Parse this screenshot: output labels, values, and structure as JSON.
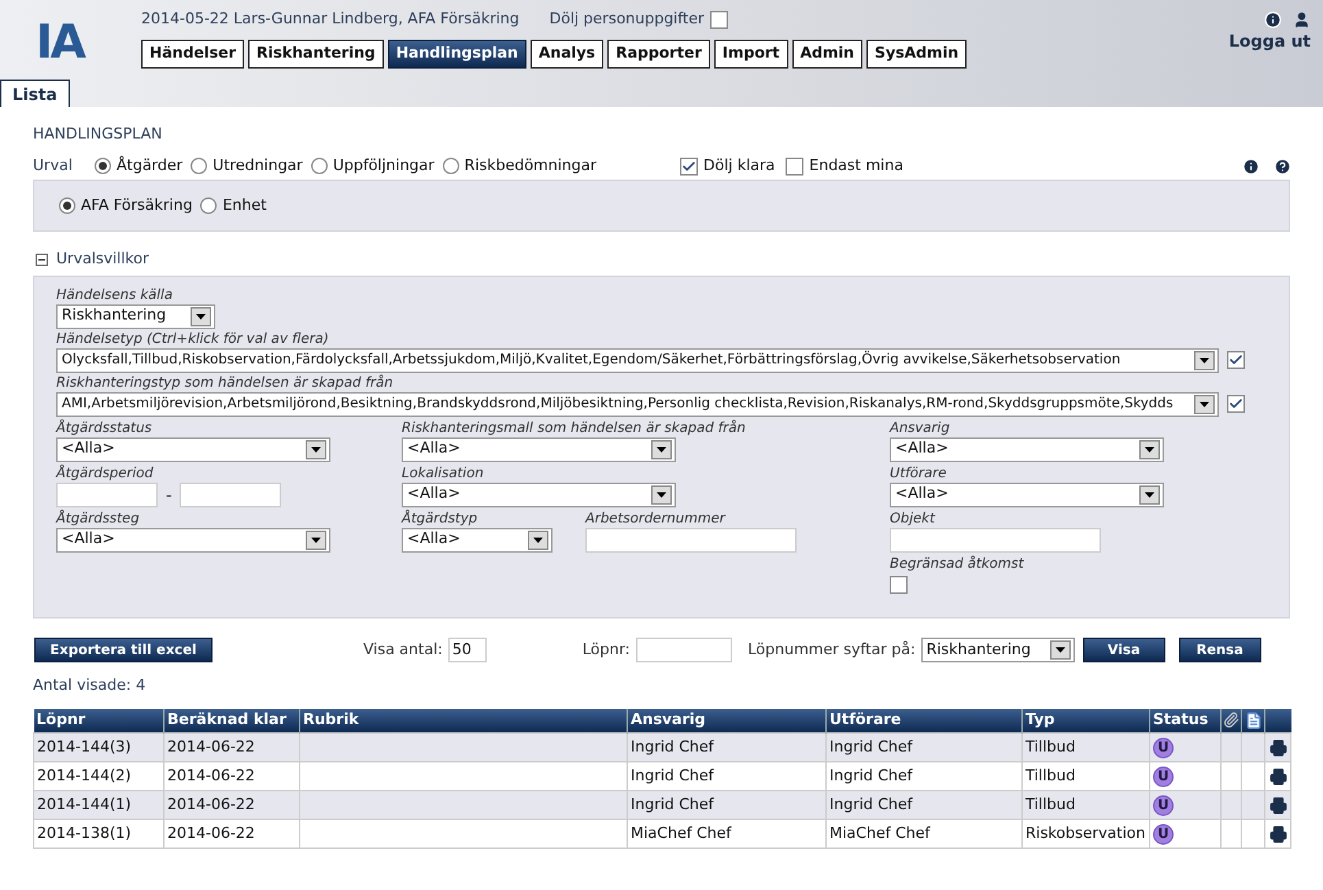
{
  "header": {
    "logo": "IA",
    "user_info": "2014-05-22 Lars-Gunnar Lindberg, AFA Försäkring",
    "hide_personal": {
      "label": "Dölj personuppgifter",
      "checked": false
    },
    "nav": [
      {
        "label": "Händelser",
        "selected": false
      },
      {
        "label": "Riskhantering",
        "selected": false
      },
      {
        "label": "Handlingsplan",
        "selected": true
      },
      {
        "label": "Analys",
        "selected": false
      },
      {
        "label": "Rapporter",
        "selected": false
      },
      {
        "label": "Import",
        "selected": false
      },
      {
        "label": "Admin",
        "selected": false
      },
      {
        "label": "SysAdmin",
        "selected": false
      }
    ],
    "logout": "Logga ut",
    "subtabs": [
      {
        "label": "Lista",
        "selected": true
      }
    ]
  },
  "page_title": "HANDLINGSPLAN",
  "urval": {
    "label": "Urval",
    "options": [
      {
        "label": "Åtgärder",
        "selected": true
      },
      {
        "label": "Utredningar",
        "selected": false
      },
      {
        "label": "Uppföljningar",
        "selected": false
      },
      {
        "label": "Riskbedömningar",
        "selected": false
      }
    ],
    "checkboxes": [
      {
        "label": "Dölj klara",
        "checked": true
      },
      {
        "label": "Endast mina",
        "checked": false
      }
    ]
  },
  "scope": [
    {
      "label": "AFA Försäkring",
      "selected": true
    },
    {
      "label": "Enhet",
      "selected": false
    }
  ],
  "filters_toggle": {
    "label": "Urvalsvillkor",
    "expanded": true
  },
  "filters": {
    "source": {
      "label": "Händelsens källa",
      "value": "Riskhantering"
    },
    "wide": [
      {
        "label": "Händelsetyp (Ctrl+klick för val av flera)",
        "value": "Olycksfall,Tillbud,Riskobservation,Färdolycksfall,Arbetssjukdom,Miljö,Kvalitet,Egendom/Säkerhet,Förbättringsförslag,Övrig avvikelse,Säkerhetsobservation",
        "checked": true
      },
      {
        "label": "Riskhanteringstyp som händelsen är skapad från",
        "value": "AMI,Arbetsmiljörevision,Arbetsmiljörond,Besiktning,Brandskyddsrond,Miljöbesiktning,Personlig checklista,Revision,Riskanalys,RM-rond,Skyddsgruppsmöte,Skydds",
        "checked": true
      }
    ],
    "columns": [
      [
        {
          "kind": "select",
          "label": "Åtgärdsstatus",
          "value": "<Alla>"
        },
        {
          "kind": "range",
          "label": "Åtgärdsperiod",
          "separator": "-"
        },
        {
          "kind": "select",
          "label": "Åtgärdssteg",
          "value": "<Alla>"
        }
      ],
      [
        {
          "kind": "select",
          "label": "Riskhanteringsmall som händelsen är skapad från",
          "value": "<Alla>"
        },
        {
          "kind": "select",
          "label": "Lokalisation",
          "value": "<Alla>"
        },
        {
          "kind": "pair",
          "items": [
            {
              "kind": "smallselect",
              "label": "Åtgärdstyp",
              "value": "<Alla>"
            },
            {
              "kind": "text",
              "label": "Arbetsordernummer"
            }
          ]
        }
      ],
      [
        {
          "kind": "select",
          "label": "Ansvarig",
          "value": "<Alla>"
        },
        {
          "kind": "select",
          "label": "Utförare",
          "value": "<Alla>"
        },
        {
          "kind": "text",
          "label": "Objekt"
        },
        {
          "kind": "checkbox",
          "label": "Begränsad åtkomst",
          "checked": false
        }
      ]
    ]
  },
  "actions": {
    "export": "Exportera till excel",
    "visa_antal": {
      "label": "Visa antal:",
      "value": "50"
    },
    "lopnr": {
      "label": "Löpnr:"
    },
    "syftar": {
      "label": "Löpnummer syftar på:",
      "value": "Riskhantering"
    },
    "buttons": [
      "Visa",
      "Rensa"
    ]
  },
  "count": "Antal visade: 4",
  "table": {
    "columns": [
      "Löpnr",
      "Beräknad klar",
      "Rubrik",
      "Ansvarig",
      "Utförare",
      "Typ",
      "Status"
    ],
    "rows": [
      {
        "cells": [
          "2014-144(3)",
          "2014-06-22",
          "",
          "Ingrid Chef",
          "Ingrid Chef",
          "Tillbud"
        ],
        "status": "U"
      },
      {
        "cells": [
          "2014-144(2)",
          "2014-06-22",
          "",
          "Ingrid Chef",
          "Ingrid Chef",
          "Tillbud"
        ],
        "status": "U"
      },
      {
        "cells": [
          "2014-144(1)",
          "2014-06-22",
          "",
          "Ingrid Chef",
          "Ingrid Chef",
          "Tillbud"
        ],
        "status": "U"
      },
      {
        "cells": [
          "2014-138(1)",
          "2014-06-22",
          "",
          "MiaChef Chef",
          "MiaChef Chef",
          "Riskobservation"
        ],
        "status": "U"
      }
    ]
  }
}
